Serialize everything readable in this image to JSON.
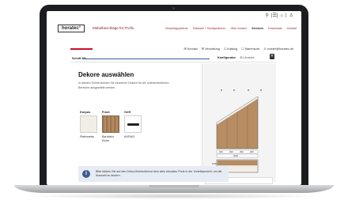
{
  "header": {
    "top_icons": [
      "⚲",
      "|☰|",
      "⌂",
      "|",
      "♙"
    ],
    "logo": "horatec°",
    "tagline": "Möbelbeschläge für Profis.",
    "nav": [
      "Beschlagsysteme",
      "Software + Konfiguratoren",
      "Über horatec",
      "Services",
      "Downloads",
      "Kontakt"
    ],
    "active_nav": "Services"
  },
  "utility": {
    "items": [
      "✉ Kontakt",
      "⚙ Verwaltung",
      "☖ Katalog",
      "☐ Warenkorb",
      "♙ muster@horatec.de"
    ]
  },
  "stepper": {
    "label": "Schritt 9/9",
    "tabs": [
      "Konfigurator",
      "3D-Ansicht"
    ],
    "trash_icon": "✕"
  },
  "content": {
    "title": "Dekore auswählen",
    "description": "In diesem Schritt können Sie einzelnen Dekore für die unterschiedlichen Bereiche ausgewählt werden.",
    "groups": [
      {
        "label": "Korpus",
        "swatch": "Platinweiss"
      },
      {
        "label": "Front",
        "swatch": "Bardolino Eiche"
      },
      {
        "label": "Griff",
        "swatch": "AVENIO"
      }
    ],
    "info_text": "Bitte klicken Sie auf den Dekor-Kleinbuttonsd dem ates einmalen Preis in der Vorteilsansicht, um die Auswahl zu ändern."
  },
  "drawing": {
    "dims": [
      "2000",
      "290",
      "290",
      "290",
      "290",
      "1000"
    ],
    "colors": {
      "wood": "#b88d63",
      "wood_dark": "#9c724c",
      "accent": "#c8102e",
      "nav_red": "#9b2432"
    }
  }
}
